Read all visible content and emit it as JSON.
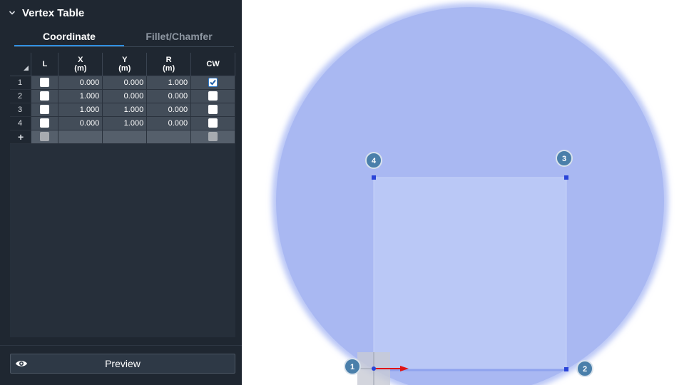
{
  "panel": {
    "title": "Vertex Table",
    "tabs": [
      {
        "label": "Coordinate",
        "active": true
      },
      {
        "label": "Fillet/Chamfer",
        "active": false
      }
    ]
  },
  "table": {
    "headers": [
      {
        "top": "L",
        "unit": ""
      },
      {
        "top": "X",
        "unit": "(m)"
      },
      {
        "top": "Y",
        "unit": "(m)"
      },
      {
        "top": "R",
        "unit": "(m)"
      },
      {
        "top": "CW",
        "unit": ""
      }
    ],
    "rows": [
      {
        "index": "1",
        "locked": false,
        "x": "0.000",
        "y": "0.000",
        "r": "1.000",
        "cw": true
      },
      {
        "index": "2",
        "locked": false,
        "x": "1.000",
        "y": "0.000",
        "r": "0.000",
        "cw": false
      },
      {
        "index": "3",
        "locked": false,
        "x": "1.000",
        "y": "1.000",
        "r": "0.000",
        "cw": false
      },
      {
        "index": "4",
        "locked": false,
        "x": "0.000",
        "y": "1.000",
        "r": "0.000",
        "cw": false
      }
    ],
    "add_row_symbol": "+"
  },
  "preview_label": "Preview",
  "viewport": {
    "vertex_labels": [
      "1",
      "2",
      "3",
      "4"
    ],
    "colors": {
      "circle_fill": "#a9b8f2",
      "square_fill": "#bac8f6",
      "vertex_badge": "#4a7faa",
      "axis_arrow": "#e01414"
    }
  }
}
